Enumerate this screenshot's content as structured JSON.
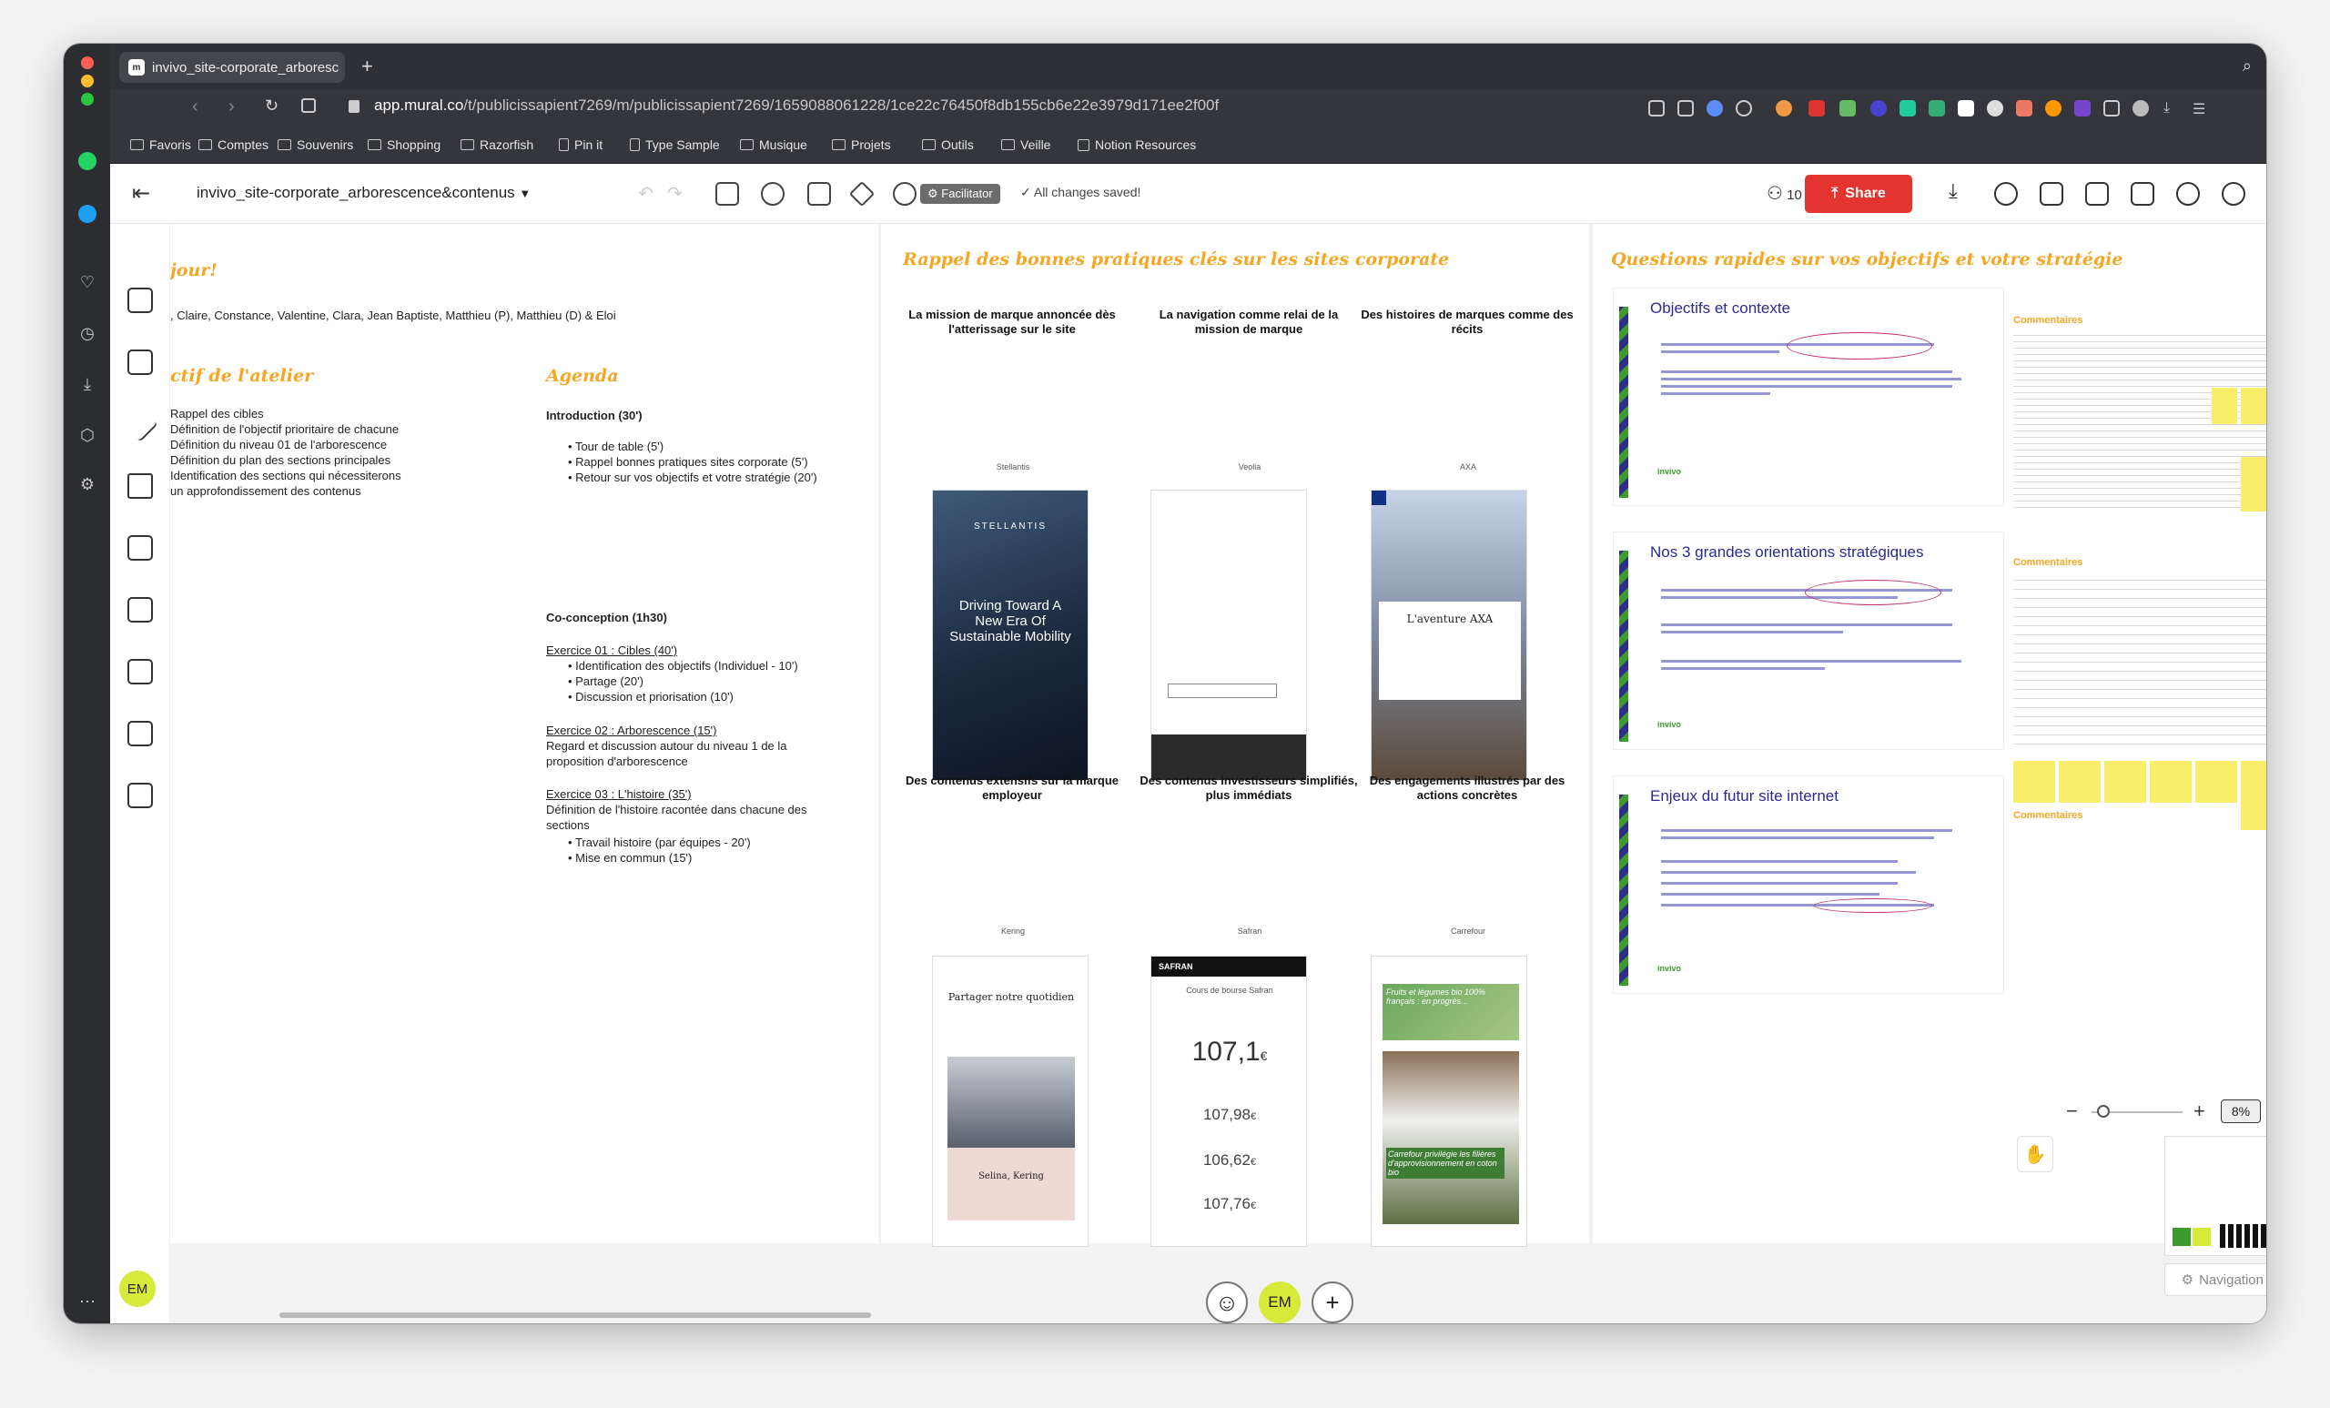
{
  "browser": {
    "tab_title": "invivo_site-corporate_arboresc",
    "url_host": "app.mural.co",
    "url_path": "/t/publicissapient7269/m/publicissapient7269/1659088061228/1ce22c76450f8db155cb6e22e3979d171ee2f00f",
    "bookmarks": [
      "Favoris",
      "Comptes",
      "Souvenirs",
      "Shopping",
      "Razorfish",
      "Pin it",
      "Type Sample",
      "Musique",
      "Projets",
      "Outils",
      "Veille",
      "Notion Resources"
    ]
  },
  "toolbar": {
    "mural_title": "invivo_site-corporate_arborescence&contenus",
    "facilitator": "Facilitator",
    "saved": "All changes saved!",
    "members": "10",
    "share": "Share"
  },
  "board1": {
    "title": "jour!",
    "participants": ", Claire, Constance, Valentine, Clara, Jean Baptiste, Matthieu (P), Matthieu (D) & Eloi",
    "objectif_title": "ctif de l'atelier",
    "objectif_items": [
      "Rappel des cibles",
      "Définition de l'objectif prioritaire de chacune",
      "Définition du niveau 01 de l'arborescence",
      "Définition du plan des sections principales",
      "Identification des sections qui nécessiterons",
      "un approfondissement des contenus"
    ],
    "agenda_title": "Agenda",
    "intro": "Introduction (30')",
    "intro_items": [
      "Tour de table (5')",
      "Rappel bonnes pratiques sites corporate (5')",
      "Retour sur vos objectifs et votre stratégie (20')"
    ],
    "coconc": "Co-conception (1h30)",
    "ex1": "Exercice 01 : Cibles (40')",
    "ex1_items": [
      "Identification des objectifs (Individuel - 10')",
      "Partage (20')",
      "Discussion et priorisation (10')"
    ],
    "ex2": "Exercice 02 : Arborescence (15')",
    "ex2_desc": "Regard et discussion autour du niveau 1 de la proposition d'arborescence",
    "ex3": "Exercice 03 : L'histoire (35')",
    "ex3_desc": "Définition de l'histoire racontée dans chacune des sections",
    "ex3_items": [
      "Travail histoire (par équipes - 20')",
      "Mise en commun (15')"
    ]
  },
  "board2": {
    "title": "Rappel des bonnes pratiques clés sur les sites corporate",
    "headers": [
      "La mission de marque annoncée dès l'atterissage sur le site",
      "La navigation comme relai de la mission de marque",
      "Des histoires de marques comme des récits",
      "Des contenus extensifs sur la marque employeur",
      "Des contenus investisseurs simplifiés, plus immédiats",
      "Des engagements illustrés par des actions concrètes"
    ],
    "brands": [
      "Stellantis",
      "Veolia",
      "AXA",
      "Kering",
      "Safran",
      "Carrefour"
    ],
    "stellantis_logo": "STELLANTIS",
    "stellantis_text": "Driving Toward A New Era Of Sustainable Mobility",
    "axa_text": "L'aventure AXA",
    "kering_text": "Partager notre quotidien",
    "kering_name": "Selina, Kering",
    "safran_logo": "SAFRAN",
    "safran_sub": "Cours de bourse Safran",
    "safran_big": "107,1",
    "safran_v2": "107,98",
    "safran_v3": "106,62",
    "safran_v4": "107,76",
    "safran_unit": "€",
    "carrefour_t1": "Fruits et légumes bio 100% français : en progrès...",
    "carrefour_t2": "Carrefour privilégie les filières d'approvisionnement en coton bio"
  },
  "board3": {
    "title": "Questions rapides sur vos objectifs et votre stratégie",
    "slides": [
      "Objectifs et contexte",
      "Nos 3 grandes orientations stratégiques",
      "Enjeux du futur site internet"
    ],
    "slide_footer": "invivo",
    "comments_label": "Commentaires"
  },
  "footer": {
    "avatar": "EM",
    "zoom": "8%",
    "nav_settings": "Navigation Settings"
  },
  "colors": {
    "accent": "#f5a623",
    "share": "#e3342f",
    "avatar_bg": "#d6ea3a",
    "slide_title": "#2a2a8f"
  }
}
